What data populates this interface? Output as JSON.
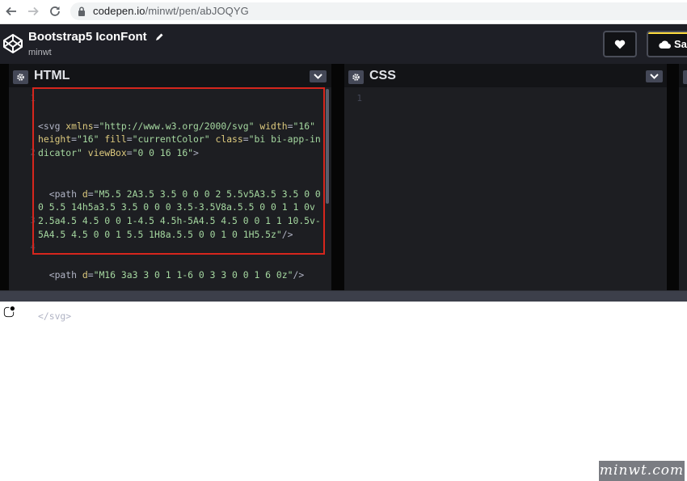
{
  "browser": {
    "url_host": "codepen.io",
    "url_path": "/minwt/pen/abJOQYG"
  },
  "header": {
    "title": "Bootstrap5 IconFont",
    "user": "minwt",
    "save_label": "Sav"
  },
  "panels": {
    "html": {
      "title": "HTML",
      "line_numbers": [
        "1",
        "2",
        "3",
        "4"
      ],
      "code": {
        "l1_tag": "<svg",
        "l1_a1": "xmlns",
        "l1_v1": "\"http://www.w3.org/2000/svg\"",
        "l1_a2": "width",
        "l1_v2": "\"16\"",
        "l1_a3": "height",
        "l1_v3": "\"16\"",
        "l1_a4": "fill",
        "l1_v4": "\"currentColor\"",
        "l1_a5": "class",
        "l1_v5": "\"bi bi-app-indicator\"",
        "l1_a6": "viewBox",
        "l1_v6": "\"0 0 16 16\"",
        "l1_end": ">",
        "l2_tag": "<path",
        "l2_a1": "d",
        "l2_v1": "\"M5.5 2A3.5 3.5 0 0 0 2 5.5v5A3.5 3.5 0 0 0 5.5 14h5a3.5 3.5 0 0 0 3.5-3.5V8a.5.5 0 0 1 1 0v2.5a4.5 4.5 0 0 1-4.5 4.5h-5A4.5 4.5 0 0 1 1 10.5v-5A4.5 4.5 0 0 1 5.5 1H8a.5.5 0 0 1 0 1H5.5z\"",
        "l2_end": "/>",
        "l3_tag": "<path",
        "l3_a1": "d",
        "l3_v1": "\"M16 3a3 3 0 1 1-6 0 3 3 0 0 1 6 0z\"",
        "l3_end": "/>",
        "l4_tag": "</svg>"
      }
    },
    "css": {
      "title": "CSS",
      "line_numbers": [
        "1"
      ]
    }
  },
  "watermark": "minwt.com",
  "colors": {
    "highlight_border": "#d6261d",
    "editor_bg": "#1d1e22",
    "header_bg": "#1e1f26",
    "save_accent": "#ffdd40"
  }
}
